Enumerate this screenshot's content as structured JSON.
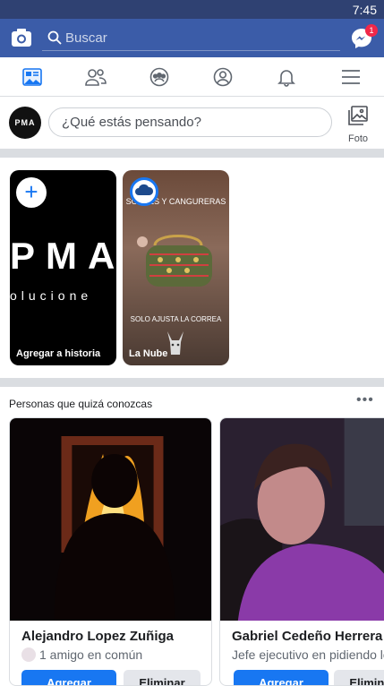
{
  "status_bar": {
    "time": "7:45"
  },
  "header": {
    "search_placeholder": "Buscar",
    "messenger_badge": "1"
  },
  "tabs": [
    {
      "name": "tab-news-feed",
      "icon": "news-feed-icon",
      "active": true
    },
    {
      "name": "tab-friends",
      "icon": "friends-icon"
    },
    {
      "name": "tab-groups",
      "icon": "groups-icon"
    },
    {
      "name": "tab-profile",
      "icon": "profile-icon"
    },
    {
      "name": "tab-notifications",
      "icon": "bell-icon"
    },
    {
      "name": "tab-menu",
      "icon": "hamburger-icon"
    }
  ],
  "composer": {
    "avatar_text": "PMA",
    "placeholder": "¿Qué estás pensando?",
    "photo_label": "Foto"
  },
  "stories": [
    {
      "caption": "Agregar a historia",
      "bg_text": "PMA",
      "bg_subtext": "olucione"
    },
    {
      "caption": "La Nube",
      "header_text": "SOBRES Y CANGURERAS",
      "footer_text": "SOLO AJUSTA LA CORREA"
    }
  ],
  "people_you_may_know": {
    "title": "Personas que quizá conozcas",
    "cards": [
      {
        "name": "Alejandro Lopez Zuñiga",
        "subtitle": "1 amigo en común",
        "add_label": "Agregar",
        "remove_label": "Eliminar"
      },
      {
        "name": "Gabriel Cedeño Herrera",
        "subtitle": "Jefe ejecutivo en pidiendo lo",
        "add_label": "Agregar",
        "remove_label": "Eliminar"
      }
    ]
  },
  "colors": {
    "header_bg": "#3b5ca8",
    "status_bg": "#2f4172",
    "accent": "#1877f2",
    "badge": "#f02849"
  }
}
